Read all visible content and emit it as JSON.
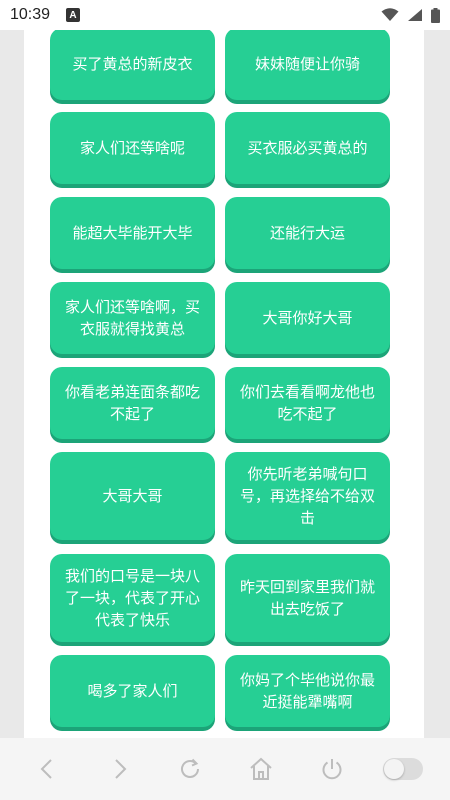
{
  "status_bar": {
    "time": "10:39",
    "notification_letter": "A"
  },
  "colors": {
    "tile": "#26cf94",
    "tile_shadow": "#1ca478",
    "nav_icon": "#bdbdbd"
  },
  "buttons": [
    "买了黄总的新皮衣",
    "妹妹随便让你骑",
    "家人们还等啥呢",
    "买衣服必买黄总的",
    "能超大毕能开大毕",
    "还能行大运",
    "家人们还等啥啊，买衣服就得找黄总",
    "大哥你好大哥",
    "你看老弟连面条都吃不起了",
    "你们去看看啊龙他也吃不起了",
    "大哥大哥",
    "你先听老弟喊句口号，再选择给不给双击",
    "我们的口号是一块八了一块，代表了开心代表了快乐",
    "昨天回到家里我们就出去吃饭了",
    "喝多了家人们",
    "你妈了个毕他说你最近挺能犟嘴啊"
  ],
  "nav": {
    "icons": [
      "back-icon",
      "forward-icon",
      "refresh-icon",
      "home-icon",
      "power-icon",
      "toggle-switch"
    ]
  }
}
